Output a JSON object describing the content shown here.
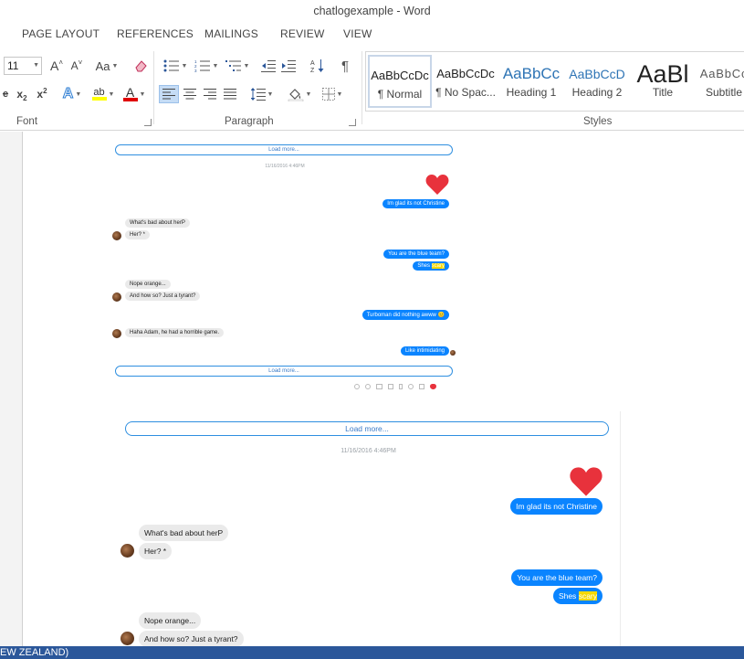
{
  "window": {
    "title": "chatlogexample - Word"
  },
  "tabs": [
    "PAGE LAYOUT",
    "REFERENCES",
    "MAILINGS",
    "REVIEW",
    "VIEW"
  ],
  "ribbon": {
    "font": {
      "label": "Font",
      "size": "11",
      "grow": "A",
      "shrink": "A",
      "case": "Aa",
      "strike": "abc",
      "subscript": "x",
      "superscript": "x",
      "effects": "A",
      "highlight": "ab",
      "color": "A"
    },
    "paragraph": {
      "label": "Paragraph",
      "pilcrow": "¶"
    },
    "styles": {
      "label": "Styles",
      "items": [
        {
          "preview": "AaBbCcDc",
          "name": "¶ Normal"
        },
        {
          "preview": "AaBbCcDc",
          "name": "¶ No Spac..."
        },
        {
          "preview": "AaBbCc",
          "name": "Heading 1"
        },
        {
          "preview": "AaBbCcD",
          "name": "Heading 2"
        },
        {
          "preview": "AaBl",
          "name": "Title"
        },
        {
          "preview": "AaBbCc",
          "name": "Subtitle"
        }
      ]
    }
  },
  "colors": {
    "accent": "#2b579a",
    "bubble_out": "#0a84ff",
    "bubble_in": "#eaeaea",
    "highlight": "#f5d800",
    "heart": "#e8323c"
  },
  "chat": {
    "load_more": "Load more...",
    "timestamp": "11/16/2016 4:46PM",
    "messages": [
      {
        "from": "me",
        "text": "Im glad its not Christine"
      },
      {
        "from": "them",
        "text": "What's bad about herP"
      },
      {
        "from": "them",
        "text": "Her? *"
      },
      {
        "from": "me",
        "text": "You are the blue team?"
      },
      {
        "from": "me",
        "text_before": "Shes ",
        "highlight": "scary"
      },
      {
        "from": "them",
        "text": "Nope orange..."
      },
      {
        "from": "them",
        "text": "And how so? Just a tyrant?"
      },
      {
        "from": "me",
        "text": "Turboman did nothing awww 😐"
      },
      {
        "from": "them",
        "text": "Haha Adam, he had a horrible game."
      },
      {
        "from": "me",
        "text": "Like intimidating"
      }
    ]
  },
  "statusbar": {
    "language": "EW ZEALAND)"
  }
}
